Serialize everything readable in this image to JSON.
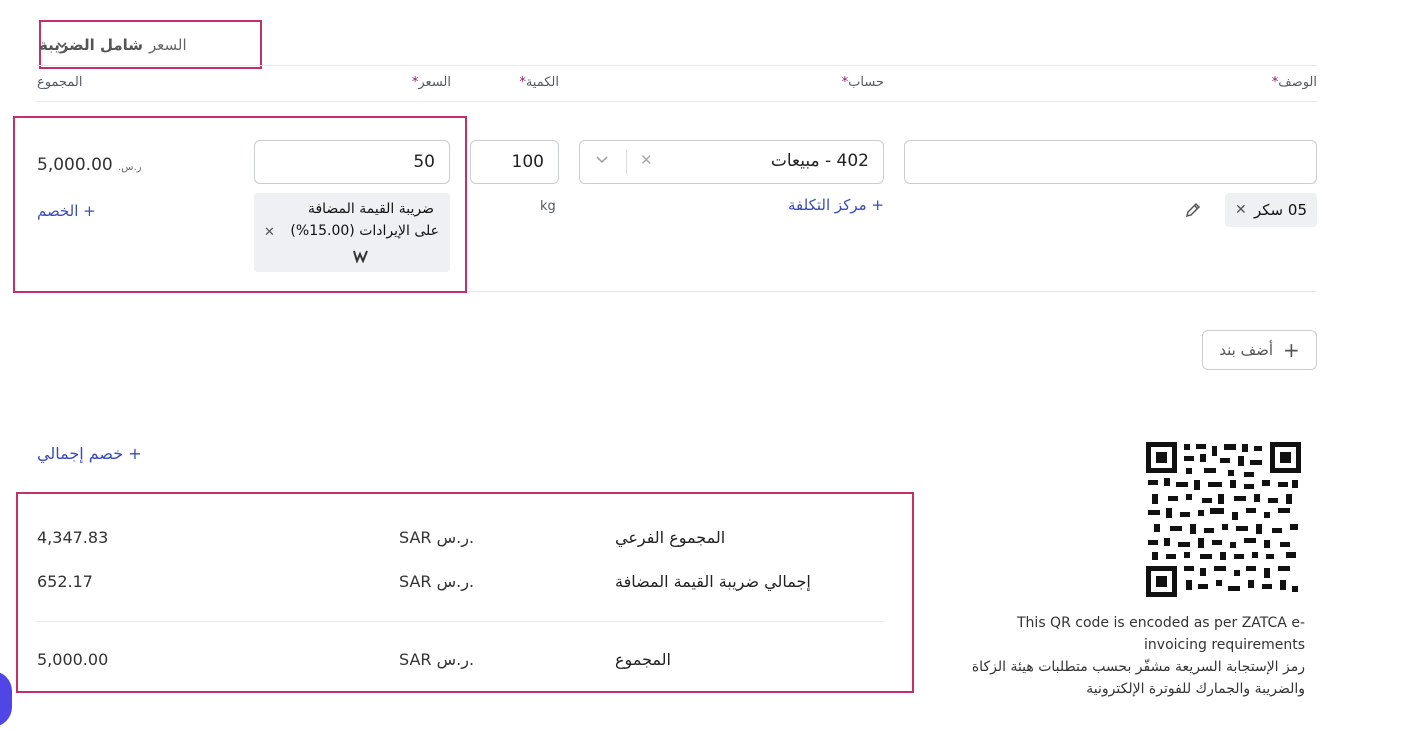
{
  "price_mode": {
    "label": "السعر",
    "value": "شامل الضريبة"
  },
  "columns": {
    "description": "الوصف",
    "account": "حساب",
    "quantity": "الكمية",
    "price": "السعر",
    "total": "المجموع",
    "required_mark": "*"
  },
  "line_item": {
    "description_value": "",
    "item_chip": "05 سكر",
    "account_value": "402 - مبيعات",
    "cost_center_link": "+ مركز التكلفة",
    "quantity_value": "100",
    "unit": "kg",
    "price_value": "50",
    "tax_chip_line1": "ضريبة القيمة المضافة",
    "tax_chip_line2": "على الإيرادات (15.00%)",
    "total_value": "5,000.00",
    "total_currency": "ر.س.",
    "discount_link": "+ الخصم"
  },
  "add_line_button": "أضف بند",
  "overall_discount_link": "+ خصم إجمالي",
  "summary": {
    "subtotal_label": "المجموع الفرعي",
    "subtotal_currency": "SAR ر.س.",
    "subtotal_value": "4,347.83",
    "vat_label": "إجمالي ضريبة القيمة المضافة",
    "vat_currency": "SAR ر.س.",
    "vat_value": "652.17",
    "total_label": "المجموع",
    "total_currency": "SAR ر.س.",
    "total_value": "5,000.00"
  },
  "qr": {
    "note_en": "This QR code is encoded as per ZATCA e-invoicing requirements",
    "note_ar": "رمز الإستجابة السريعة مشفّر بحسب متطلبات هيئة الزكاة والضريبة والجمارك للفوترة الإلكترونية"
  },
  "colors": {
    "highlight": "#c2306b",
    "link": "#3a4bb8",
    "required": "#8a1a6b",
    "fab": "#4f46e5"
  }
}
